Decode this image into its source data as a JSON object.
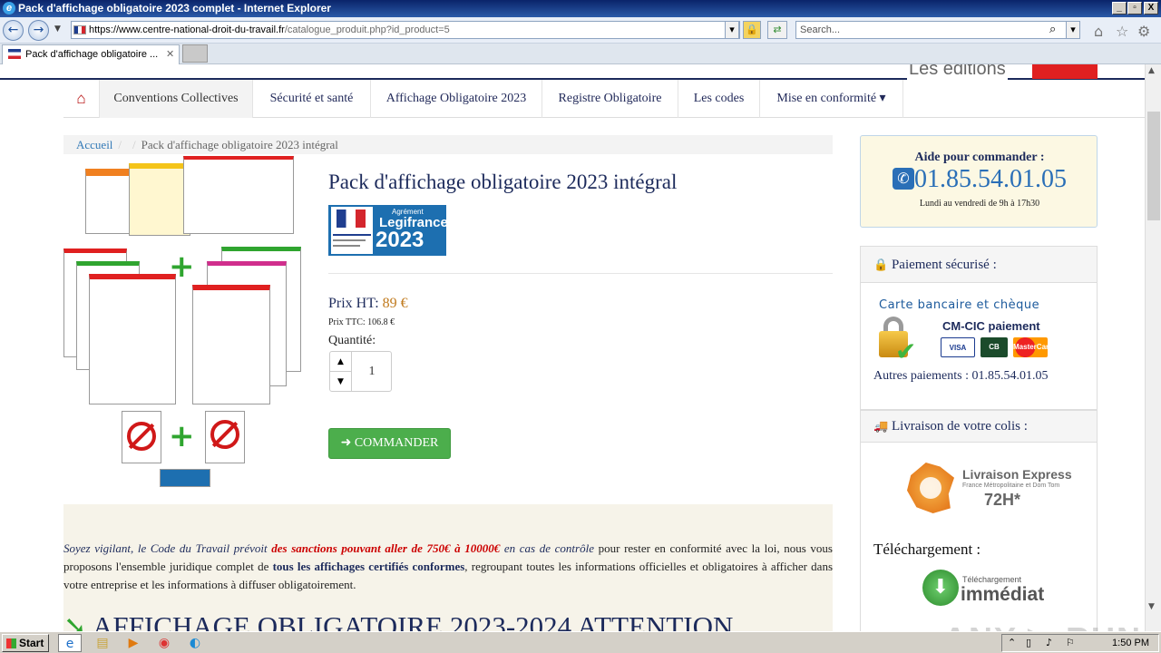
{
  "browser": {
    "window_title": "Pack d'affichage obligatoire 2023 complet - Internet Explorer",
    "address_host": "https://www.centre-national-droit-du-travail.fr",
    "address_path": "/catalogue_produit.php?id_product=5",
    "search_placeholder": "Search...",
    "tab_label": "Pack d'affichage obligatoire ...",
    "min": "_",
    "max": "▫",
    "close": "X"
  },
  "site": {
    "editions_label": "Les éditions",
    "nav": [
      "Conventions Collectives",
      "Sécurité et santé",
      "Affichage Obligatoire 2023",
      "Registre Obligatoire",
      "Les codes",
      "Mise en conformité ▾"
    ],
    "breadcrumb_home": "Accueil",
    "breadcrumb_current": "Pack d'affichage obligatoire 2023 intégral"
  },
  "product": {
    "title": "Pack d'affichage obligatoire 2023 intégral",
    "badge_small": "Agrément",
    "badge_name": "Legifrance",
    "badge_year": "2023",
    "price_ht_label": "Prix HT:",
    "price_ht_value": "89 €",
    "price_ttc": "Prix TTC: 106.8 €",
    "quantity_label": "Quantité:",
    "quantity_value": "1",
    "order_button": "➜ COMMANDER"
  },
  "description": {
    "p1_italic": "Soyez vigilant, le Code du Travail prévoit ",
    "p1_red": "des sanctions pouvant aller de 750€ à 10000€",
    "p1_italic2": " en cas de contrôle",
    "p1_text": " pour rester en conformité avec la loi, nous vous proposons l'ensemble juridique complet de ",
    "p1_bold": "tous les affichages certifiés conformes",
    "p1_text2": ", regroupant toutes les informations officielles et obligatoires à afficher dans votre entreprise et les informations à diffuser obligatoirement.",
    "heading": "AFFICHAGE OBLIGATOIRE 2023-2024 ATTENTION"
  },
  "sidebar": {
    "aide_title": "Aide pour commander :",
    "aide_phone": "01.85.54.01.05",
    "aide_hours": "Lundi au vendredi de 9h à 17h30",
    "pay_header": "Paiement sécurisé :",
    "pay_cb": "Carte bancaire et chèque",
    "pay_cmcic": "CM-CIC paiement",
    "pay_other": "Autres paiements : 01.85.54.01.05",
    "cards": [
      "VISA",
      "CB",
      "MasterCard"
    ],
    "livraison_header": "Livraison de votre colis :",
    "liv_express": "Livraison Express",
    "liv_sub": "France Métropolitaine et Dom Tom",
    "liv_72": "72H*",
    "telechargement": "Téléchargement :",
    "dl_small": "Téléchargement",
    "dl_big": "immédiat"
  },
  "watermark": "ANY ▶ RUN",
  "taskbar": {
    "start": "Start",
    "clock": "1:50 PM"
  },
  "colors": {
    "navy": "#1c2a5b",
    "green_button": "#4cae4c",
    "price_orange": "#c07a1d",
    "red_alert": "#cc0000",
    "link_blue": "#337ab7"
  }
}
